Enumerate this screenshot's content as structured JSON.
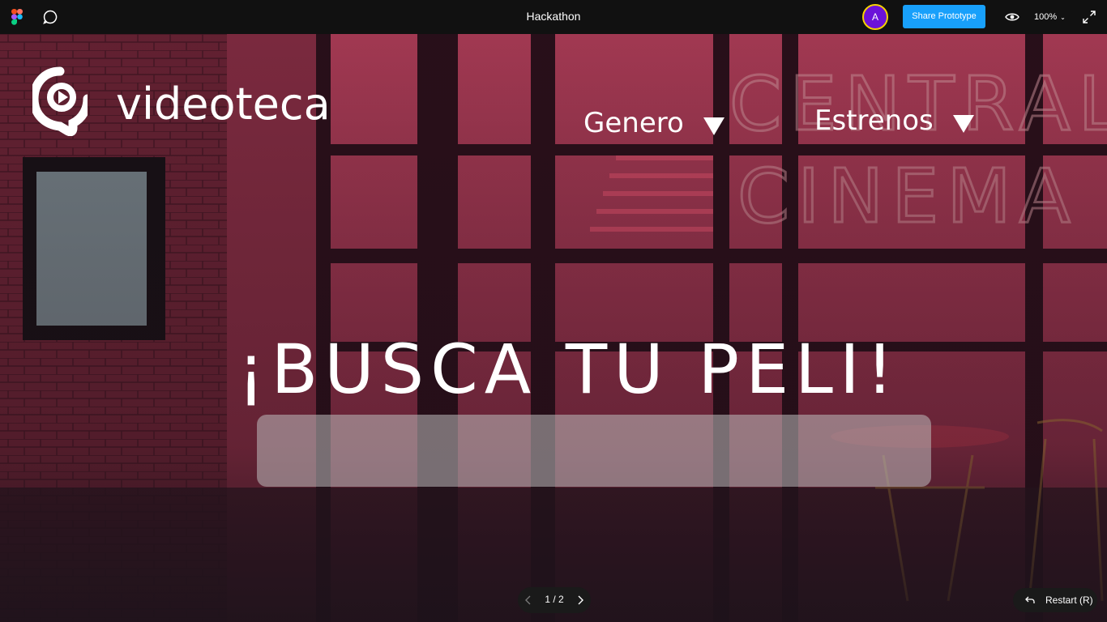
{
  "topbar": {
    "file_title": "Hackathon",
    "avatar_initial": "A",
    "share_label": "Share Prototype",
    "zoom_label": "100%"
  },
  "prototype": {
    "brand_name": "videoteca",
    "nav": [
      {
        "label": "Genero"
      },
      {
        "label": "Estrenos"
      }
    ],
    "headline": "¡BUSCA TU PELI!",
    "search": {
      "value": "",
      "placeholder": ""
    },
    "background_sign": [
      "CENTRAL",
      "CINEMA"
    ]
  },
  "footer": {
    "page_indicator": "1 / 2",
    "restart_label": "Restart (R)"
  },
  "colors": {
    "topbar_bg": "#111111",
    "share_button": "#18a0fb",
    "avatar_bg": "#6b12d9",
    "avatar_ring": "#f5d200",
    "wall_red": "#b0354f"
  }
}
